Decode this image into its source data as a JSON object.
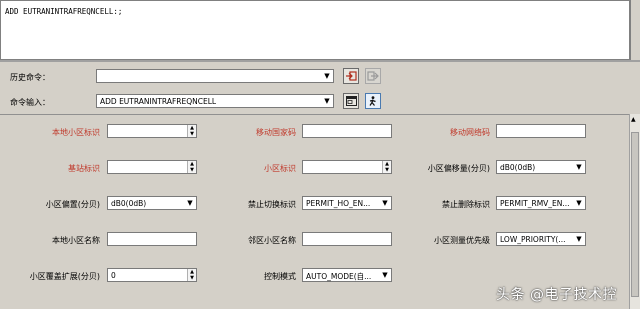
{
  "command_area": {
    "text": "ADD EUTRANINTRAFREQNCELL:;"
  },
  "history": {
    "label": "历史命令：",
    "value": ""
  },
  "command_input": {
    "label": "命令输入：",
    "value": "ADD EUTRANINTRAFREQNCELL"
  },
  "icons": {
    "history_action": "import-arrow-icon",
    "history_disabled": "export-arrow-icon",
    "cmd_action": "window-icon",
    "cmd_run": "run-person-icon",
    "dropdown": "chevron-down-icon",
    "spinner": "spinner-icon"
  },
  "form": {
    "row1": {
      "local_cell_id": {
        "label": "本地小区标识",
        "value": ""
      },
      "mcc": {
        "label": "移动国家码",
        "value": ""
      },
      "mnc": {
        "label": "移动网络码",
        "value": ""
      }
    },
    "row2": {
      "enodeb_id": {
        "label": "基站标识",
        "value": ""
      },
      "cell_id": {
        "label": "小区标识",
        "value": ""
      },
      "cell_offset": {
        "label": "小区偏移量(分贝)",
        "value": "dB0(0dB)"
      }
    },
    "row3": {
      "cell_qoffset": {
        "label": "小区偏置(分贝)",
        "value": "dB0(0dB)"
      },
      "no_ho_ind": {
        "label": "禁止切换标识",
        "value": "PERMIT_HO_EN..."
      },
      "no_remove_ind": {
        "label": "禁止删除标识",
        "value": "PERMIT_RMV_EN..."
      }
    },
    "row4": {
      "local_cell_name": {
        "label": "本地小区名称",
        "value": ""
      },
      "neighbour_cell_name": {
        "label": "邻区小区名称",
        "value": ""
      },
      "meas_priority": {
        "label": "小区测量优先级",
        "value": "LOW_PRIORITY(..."
      }
    },
    "row5": {
      "coverage_ext": {
        "label": "小区覆盖扩展(分贝)",
        "value": "0"
      },
      "control_mode": {
        "label": "控制模式",
        "value": "AUTO_MODE(自..."
      }
    }
  },
  "colors": {
    "required_label": "#c0392b",
    "panel_bg": "#d4d0c8"
  },
  "watermark": {
    "text": "头条 @电子技术控"
  }
}
